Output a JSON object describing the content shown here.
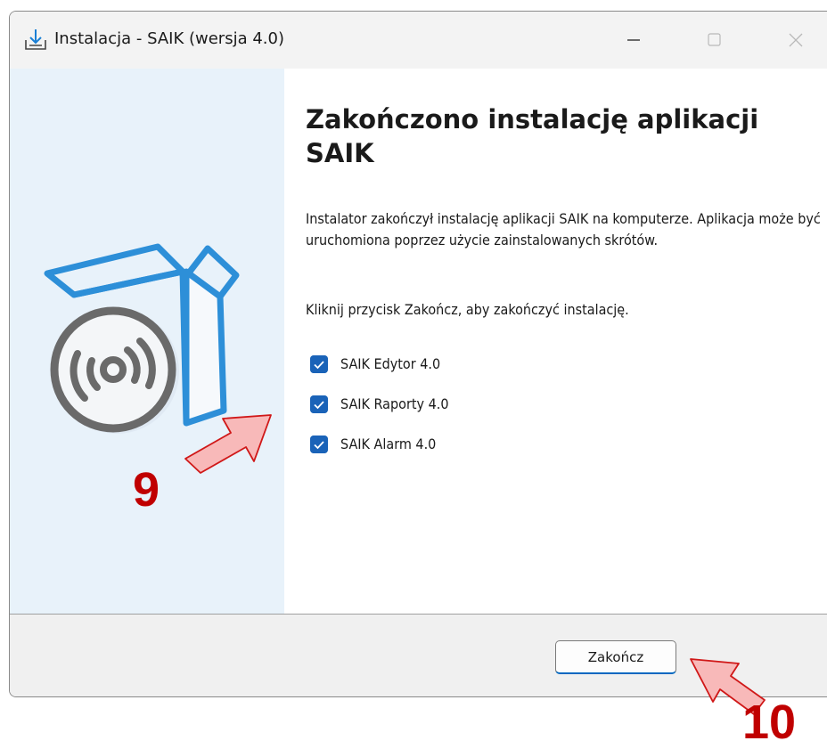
{
  "window": {
    "title": "Instalacja - SAIK (wersja 4.0)"
  },
  "main": {
    "heading": "Zakończono instalację aplikacji SAIK",
    "description": "Instalator zakończył instalację aplikacji SAIK na komputerze. Aplikacja może być uruchomiona poprzez użycie zainstalowanych skrótów.",
    "hint": "Kliknij przycisk Zakończ, aby zakończyć instalację.",
    "options": [
      {
        "label": "SAIK Edytor 4.0",
        "checked": true
      },
      {
        "label": "SAIK Raporty 4.0",
        "checked": true
      },
      {
        "label": "SAIK Alarm 4.0",
        "checked": true
      }
    ]
  },
  "footer": {
    "finish_label": "Zakończ"
  },
  "annotations": {
    "step_9": "9",
    "step_10": "10"
  },
  "colors": {
    "accent": "#1a63b8",
    "side_panel": "#e8f2fa",
    "annotation_fill": "#f8b9b9",
    "annotation_stroke": "#d01818",
    "annotation_text": "#c00000"
  },
  "icons": {
    "app": "download-install-icon",
    "box": "software-box-disc-icon"
  }
}
